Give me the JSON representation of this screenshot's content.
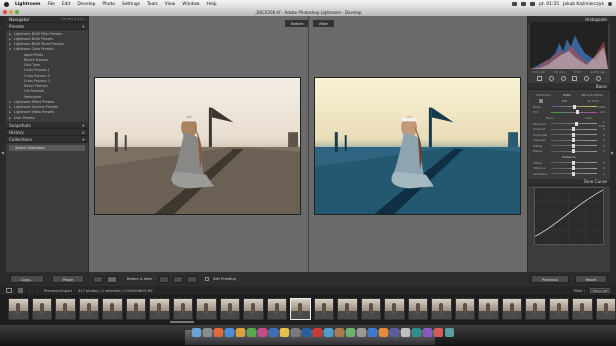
{
  "menubar": {
    "items": [
      "Lightroom",
      "File",
      "Edit",
      "Develop",
      "Photo",
      "Settings",
      "Tools",
      "View",
      "Window",
      "Help"
    ],
    "clock": "pt. 01:25",
    "user": "Jakub Kaźmierczyk"
  },
  "window": {
    "title": "_DSC6206.tif - Adobe Photoshop Lightroom - Develop"
  },
  "left_panel": {
    "navigator": {
      "label": "Navigator",
      "zoom": "FIT  FILL  1:1  3:1"
    },
    "presets": {
      "label": "Presets",
      "items": [
        {
          "label": "Lightroom B&W Filter Presets",
          "child": false
        },
        {
          "label": "Lightroom B&W Presets",
          "child": false
        },
        {
          "label": "Lightroom B&W Toned Presets",
          "child": false
        },
        {
          "label": "Lightroom Color Presets",
          "child": false
        },
        {
          "label": "Aged Photo",
          "child": true
        },
        {
          "label": "Bleach Bypass",
          "child": true
        },
        {
          "label": "Cold Tone",
          "child": true
        },
        {
          "label": "Cross Process 1",
          "child": true
        },
        {
          "label": "Cross Process 2",
          "child": true
        },
        {
          "label": "Cross Process 3",
          "child": true
        },
        {
          "label": "Direct Positive",
          "child": true
        },
        {
          "label": "Old Polaroid",
          "child": true
        },
        {
          "label": "Yesteryear",
          "child": true
        },
        {
          "label": "Lightroom Effect Presets",
          "child": false
        },
        {
          "label": "Lightroom General Presets",
          "child": false
        },
        {
          "label": "Lightroom Video Presets",
          "child": false
        },
        {
          "label": "User Presets",
          "child": false
        }
      ]
    },
    "snapshots": {
      "label": "Snapshots"
    },
    "history": {
      "label": "History"
    },
    "collections": {
      "label": "Collections",
      "items": [
        "Smart Collections"
      ]
    },
    "copy_label": "Copy...",
    "paste_label": "Paste"
  },
  "center": {
    "before_label": "Before",
    "after_label": "After"
  },
  "toolbar": {
    "view_mode": "Before & After :",
    "soft_proofing": "Soft Proofing"
  },
  "right_panel": {
    "histogram_label": "Histogram",
    "histogram_readout": [
      "ISO 100",
      "50 mm",
      "f/1.8",
      "1/250 sec"
    ],
    "basic_label": "Basic",
    "treatment_tabs": [
      "Treatment :",
      "Color",
      "Black & White"
    ],
    "wb": {
      "label": "WB :",
      "value": "As Shot"
    },
    "temp": {
      "label": "Temp",
      "value": "4700"
    },
    "tint": {
      "label": "Tint",
      "value": "+14"
    },
    "tone": {
      "label": "Tone",
      "auto": "Auto"
    },
    "sliders_tone": [
      {
        "label": "Exposure",
        "value": "+ 0.40",
        "pos": 0.58
      },
      {
        "label": "Contrast",
        "value": "0",
        "pos": 0.5
      },
      {
        "label": "Highlights",
        "value": "0",
        "pos": 0.5
      },
      {
        "label": "Shadows",
        "value": "0",
        "pos": 0.5
      },
      {
        "label": "Whites",
        "value": "0",
        "pos": 0.5
      },
      {
        "label": "Blacks",
        "value": "0",
        "pos": 0.5
      }
    ],
    "presence": {
      "label": "Presence"
    },
    "sliders_presence": [
      {
        "label": "Clarity",
        "value": "0",
        "pos": 0.5
      },
      {
        "label": "Vibrance",
        "value": "0",
        "pos": 0.5
      },
      {
        "label": "Saturation",
        "value": "0",
        "pos": 0.5
      }
    ],
    "tone_curve_label": "Tone Curve",
    "previous_label": "Previous",
    "reset_label": "Reset"
  },
  "filmstrip": {
    "source": "Previous Import",
    "count": "417 photos / 1 selected / CONQUINHO.RZ",
    "filter_label": "Filter :",
    "filter_value": "Filters Off",
    "thumb_count": 26
  },
  "colors": {
    "accent": "#1f6b8f",
    "panel": "#3c3c3c",
    "workspace": "#6a6a6a"
  }
}
